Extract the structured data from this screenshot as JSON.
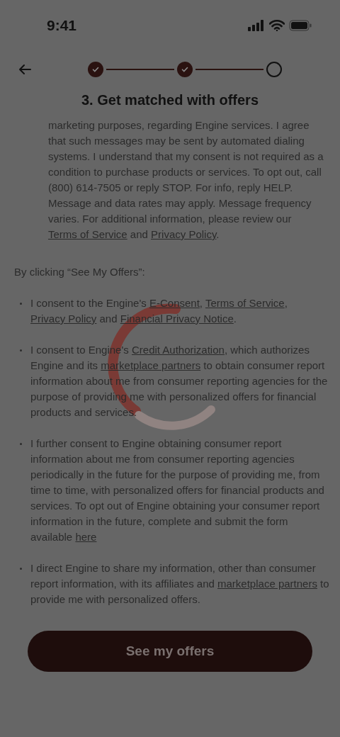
{
  "status_bar": {
    "time": "9:41"
  },
  "stepper": {
    "steps": [
      {
        "completed": true
      },
      {
        "completed": true
      },
      {
        "completed": false
      }
    ]
  },
  "title": "3. Get matched with offers",
  "sms_consent": [
    {
      "kind": "text",
      "text": "marketing purposes, regarding Engine services. I agree that such messages may be sent by automated dialing systems. I understand that my consent is not required as a condition to purchase products or services. To opt out, call (800) 614-7505 or reply STOP. For info, reply HELP. Message and data rates may apply. Message frequency varies. For additional information, please review our "
    },
    {
      "kind": "link",
      "text": "Terms of Service"
    },
    {
      "kind": "text",
      "text": " and "
    },
    {
      "kind": "link",
      "text": "Privacy Policy"
    },
    {
      "kind": "text",
      "text": "."
    }
  ],
  "intro": "By clicking “See My Offers”:",
  "bullets": [
    [
      {
        "kind": "text",
        "text": "I consent to the Engine's "
      },
      {
        "kind": "link",
        "text": "E-Consent"
      },
      {
        "kind": "text",
        "text": ", "
      },
      {
        "kind": "link",
        "text": "Terms of Service"
      },
      {
        "kind": "text",
        "text": ", "
      },
      {
        "kind": "link",
        "text": "Privacy Policy"
      },
      {
        "kind": "text",
        "text": " and "
      },
      {
        "kind": "link",
        "text": "Financial Privacy Notice"
      },
      {
        "kind": "text",
        "text": "."
      }
    ],
    [
      {
        "kind": "text",
        "text": "I consent to Engine's "
      },
      {
        "kind": "link",
        "text": "Credit Authorization"
      },
      {
        "kind": "text",
        "text": ", which authorizes Engine and its "
      },
      {
        "kind": "link",
        "text": "marketplace partners"
      },
      {
        "kind": "text",
        "text": " to obtain consumer report information about me from consumer reporting agencies for the purpose of providing me with personalized offers for financial products and services."
      }
    ],
    [
      {
        "kind": "text",
        "text": "I further consent to Engine obtaining consumer report information about me from consumer reporting agencies periodically in the future for the purpose of providing me, from time to time, with personalized offers for financial products and services. To opt out of Engine obtaining your consumer report information in the future, complete and submit the form available "
      },
      {
        "kind": "link",
        "text": "here"
      }
    ],
    [
      {
        "kind": "text",
        "text": "I direct Engine to share my information, other than consumer report information, with its affiliates and "
      },
      {
        "kind": "link",
        "text": "marketplace partners"
      },
      {
        "kind": "text",
        "text": " to provide me with personalized offers."
      }
    ]
  ],
  "primary_button": {
    "label": "See my offers"
  },
  "loading": true
}
